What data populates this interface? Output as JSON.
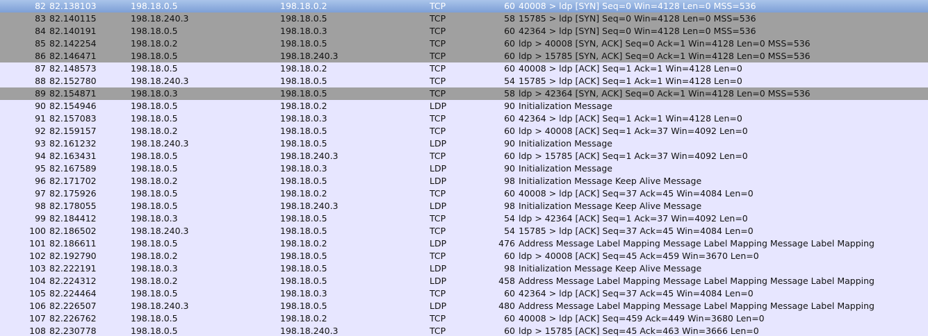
{
  "packets": [
    {
      "no": "82",
      "time": "82.138103",
      "src": "198.18.0.5",
      "dst": "198.18.0.2",
      "proto": "TCP",
      "len": "60",
      "info": "40008 > ldp [SYN] Seq=0 Win=4128 Len=0 MSS=536",
      "style": "sel"
    },
    {
      "no": "83",
      "time": "82.140115",
      "src": "198.18.240.3",
      "dst": "198.18.0.5",
      "proto": "TCP",
      "len": "58",
      "info": "15785 > ldp [SYN] Seq=0 Win=4128 Len=0 MSS=536",
      "style": "syn"
    },
    {
      "no": "84",
      "time": "82.140191",
      "src": "198.18.0.5",
      "dst": "198.18.0.3",
      "proto": "TCP",
      "len": "60",
      "info": "42364 > ldp [SYN] Seq=0 Win=4128 Len=0 MSS=536",
      "style": "syn"
    },
    {
      "no": "85",
      "time": "82.142254",
      "src": "198.18.0.2",
      "dst": "198.18.0.5",
      "proto": "TCP",
      "len": "60",
      "info": "ldp > 40008 [SYN, ACK] Seq=0 Ack=1 Win=4128 Len=0 MSS=536",
      "style": "syn"
    },
    {
      "no": "86",
      "time": "82.146471",
      "src": "198.18.0.5",
      "dst": "198.18.240.3",
      "proto": "TCP",
      "len": "60",
      "info": "ldp > 15785 [SYN, ACK] Seq=0 Ack=1 Win=4128 Len=0 MSS=536",
      "style": "syn"
    },
    {
      "no": "87",
      "time": "82.148573",
      "src": "198.18.0.5",
      "dst": "198.18.0.2",
      "proto": "TCP",
      "len": "60",
      "info": "40008 > ldp [ACK] Seq=1 Ack=1 Win=4128 Len=0",
      "style": "normal"
    },
    {
      "no": "88",
      "time": "82.152780",
      "src": "198.18.240.3",
      "dst": "198.18.0.5",
      "proto": "TCP",
      "len": "54",
      "info": "15785 > ldp [ACK] Seq=1 Ack=1 Win=4128 Len=0",
      "style": "normal"
    },
    {
      "no": "89",
      "time": "82.154871",
      "src": "198.18.0.3",
      "dst": "198.18.0.5",
      "proto": "TCP",
      "len": "58",
      "info": "ldp > 42364 [SYN, ACK] Seq=0 Ack=1 Win=4128 Len=0 MSS=536",
      "style": "syn"
    },
    {
      "no": "90",
      "time": "82.154946",
      "src": "198.18.0.5",
      "dst": "198.18.0.2",
      "proto": "LDP",
      "len": "90",
      "info": "Initialization Message",
      "style": "normal"
    },
    {
      "no": "91",
      "time": "82.157083",
      "src": "198.18.0.5",
      "dst": "198.18.0.3",
      "proto": "TCP",
      "len": "60",
      "info": "42364 > ldp [ACK] Seq=1 Ack=1 Win=4128 Len=0",
      "style": "normal"
    },
    {
      "no": "92",
      "time": "82.159157",
      "src": "198.18.0.2",
      "dst": "198.18.0.5",
      "proto": "TCP",
      "len": "60",
      "info": "ldp > 40008 [ACK] Seq=1 Ack=37 Win=4092 Len=0",
      "style": "normal"
    },
    {
      "no": "93",
      "time": "82.161232",
      "src": "198.18.240.3",
      "dst": "198.18.0.5",
      "proto": "LDP",
      "len": "90",
      "info": "Initialization Message",
      "style": "normal"
    },
    {
      "no": "94",
      "time": "82.163431",
      "src": "198.18.0.5",
      "dst": "198.18.240.3",
      "proto": "TCP",
      "len": "60",
      "info": "ldp > 15785 [ACK] Seq=1 Ack=37 Win=4092 Len=0",
      "style": "normal"
    },
    {
      "no": "95",
      "time": "82.167589",
      "src": "198.18.0.5",
      "dst": "198.18.0.3",
      "proto": "LDP",
      "len": "90",
      "info": "Initialization Message",
      "style": "normal"
    },
    {
      "no": "96",
      "time": "82.171702",
      "src": "198.18.0.2",
      "dst": "198.18.0.5",
      "proto": "LDP",
      "len": "98",
      "info": "Initialization Message Keep Alive Message",
      "style": "normal"
    },
    {
      "no": "97",
      "time": "82.175926",
      "src": "198.18.0.5",
      "dst": "198.18.0.2",
      "proto": "TCP",
      "len": "60",
      "info": "40008 > ldp [ACK] Seq=37 Ack=45 Win=4084 Len=0",
      "style": "normal"
    },
    {
      "no": "98",
      "time": "82.178055",
      "src": "198.18.0.5",
      "dst": "198.18.240.3",
      "proto": "LDP",
      "len": "98",
      "info": "Initialization Message Keep Alive Message",
      "style": "normal"
    },
    {
      "no": "99",
      "time": "82.184412",
      "src": "198.18.0.3",
      "dst": "198.18.0.5",
      "proto": "TCP",
      "len": "54",
      "info": "ldp > 42364 [ACK] Seq=1 Ack=37 Win=4092 Len=0",
      "style": "normal"
    },
    {
      "no": "100",
      "time": "82.186502",
      "src": "198.18.240.3",
      "dst": "198.18.0.5",
      "proto": "TCP",
      "len": "54",
      "info": "15785 > ldp [ACK] Seq=37 Ack=45 Win=4084 Len=0",
      "style": "normal"
    },
    {
      "no": "101",
      "time": "82.186611",
      "src": "198.18.0.5",
      "dst": "198.18.0.2",
      "proto": "LDP",
      "len": "476",
      "info": "Address Message Label Mapping Message Label Mapping Message Label Mapping",
      "style": "normal"
    },
    {
      "no": "102",
      "time": "82.192790",
      "src": "198.18.0.2",
      "dst": "198.18.0.5",
      "proto": "TCP",
      "len": "60",
      "info": "ldp > 40008 [ACK] Seq=45 Ack=459 Win=3670 Len=0",
      "style": "normal"
    },
    {
      "no": "103",
      "time": "82.222191",
      "src": "198.18.0.3",
      "dst": "198.18.0.5",
      "proto": "LDP",
      "len": "98",
      "info": "Initialization Message Keep Alive Message",
      "style": "normal"
    },
    {
      "no": "104",
      "time": "82.224312",
      "src": "198.18.0.2",
      "dst": "198.18.0.5",
      "proto": "LDP",
      "len": "458",
      "info": "Address Message Label Mapping Message Label Mapping Message Label Mapping",
      "style": "normal"
    },
    {
      "no": "105",
      "time": "82.224464",
      "src": "198.18.0.5",
      "dst": "198.18.0.3",
      "proto": "TCP",
      "len": "60",
      "info": "42364 > ldp [ACK] Seq=37 Ack=45 Win=4084 Len=0",
      "style": "normal"
    },
    {
      "no": "106",
      "time": "82.226507",
      "src": "198.18.240.3",
      "dst": "198.18.0.5",
      "proto": "LDP",
      "len": "480",
      "info": "Address Message Label Mapping Message Label Mapping Message Label Mapping",
      "style": "normal"
    },
    {
      "no": "107",
      "time": "82.226762",
      "src": "198.18.0.5",
      "dst": "198.18.0.2",
      "proto": "TCP",
      "len": "60",
      "info": "40008 > ldp [ACK] Seq=459 Ack=449 Win=3680 Len=0",
      "style": "normal"
    },
    {
      "no": "108",
      "time": "82.230778",
      "src": "198.18.0.5",
      "dst": "198.18.240.3",
      "proto": "TCP",
      "len": "60",
      "info": "ldp > 15785 [ACK] Seq=45 Ack=463 Win=3666 Len=0",
      "style": "normal"
    }
  ],
  "colors": {
    "selected_row": "#7d9fd6",
    "syn_row": "#a0a0a0",
    "default_row": "#e7e6ff"
  }
}
